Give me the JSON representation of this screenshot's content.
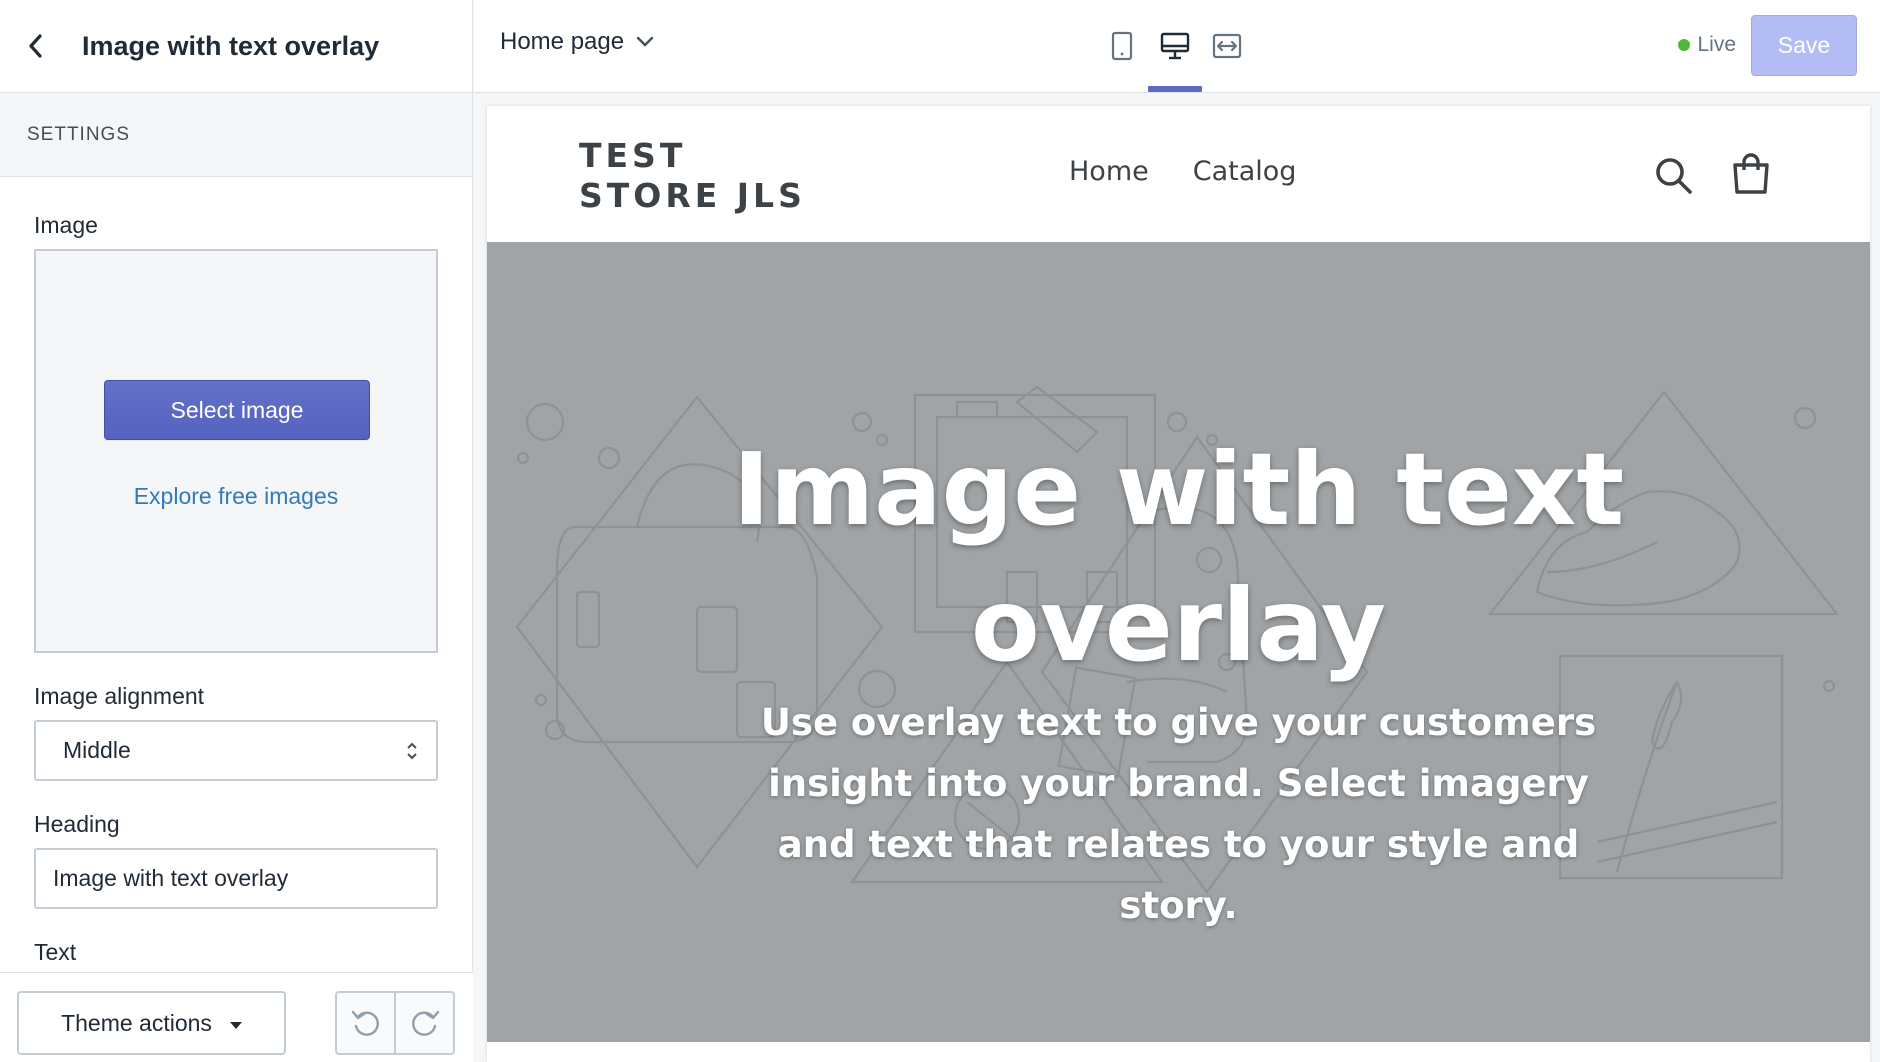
{
  "sidebar": {
    "title": "Image with text overlay",
    "section_label": "SETTINGS",
    "image_label": "Image",
    "select_image_label": "Select image",
    "explore_images_label": "Explore free images",
    "alignment_label": "Image alignment",
    "alignment_value": "Middle",
    "heading_label": "Heading",
    "heading_value": "Image with text overlay",
    "text_label": "Text",
    "theme_actions_label": "Theme actions"
  },
  "topbar": {
    "page_selector": "Home page",
    "live_label": "Live",
    "save_label": "Save",
    "active_device": "desktop"
  },
  "preview": {
    "store_name": "TEST STORE JLS",
    "nav": [
      "Home",
      "Catalog"
    ],
    "hero_heading": "Image with text overlay",
    "hero_text": "Use overlay text to give your customers insight into your brand. Select imagery and text that relates to your style and story."
  },
  "colors": {
    "accent": "#5c6ac4",
    "save_disabled": "#b3bcf5",
    "live": "#50b83c",
    "hero_bg": "#a0a4a6",
    "link": "#337ab7"
  }
}
